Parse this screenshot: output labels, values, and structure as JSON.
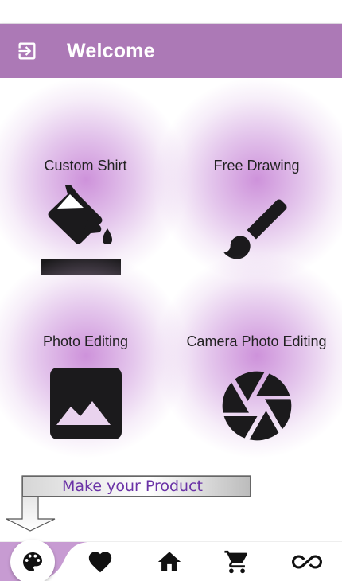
{
  "app_bar": {
    "title": "Welcome",
    "exit_icon": "exit-to-app-icon",
    "color": "#ac79b6"
  },
  "cards": [
    {
      "label": "Custom Shirt",
      "icon": "format-color-fill-icon"
    },
    {
      "label": "Free Drawing",
      "icon": "brush-icon"
    },
    {
      "label": "Photo Editing",
      "icon": "image-icon"
    },
    {
      "label": "Camera Photo Editing",
      "icon": "camera-shutter-icon"
    }
  ],
  "hint": {
    "text": "Make your Product",
    "text_color": "#6a32a6"
  },
  "bottom_nav": {
    "active_icon": "palette-icon",
    "items": [
      "favorite-icon",
      "home-icon",
      "shopping-cart-icon",
      "infinity-icon"
    ],
    "accent_color": "#c79bd2"
  }
}
